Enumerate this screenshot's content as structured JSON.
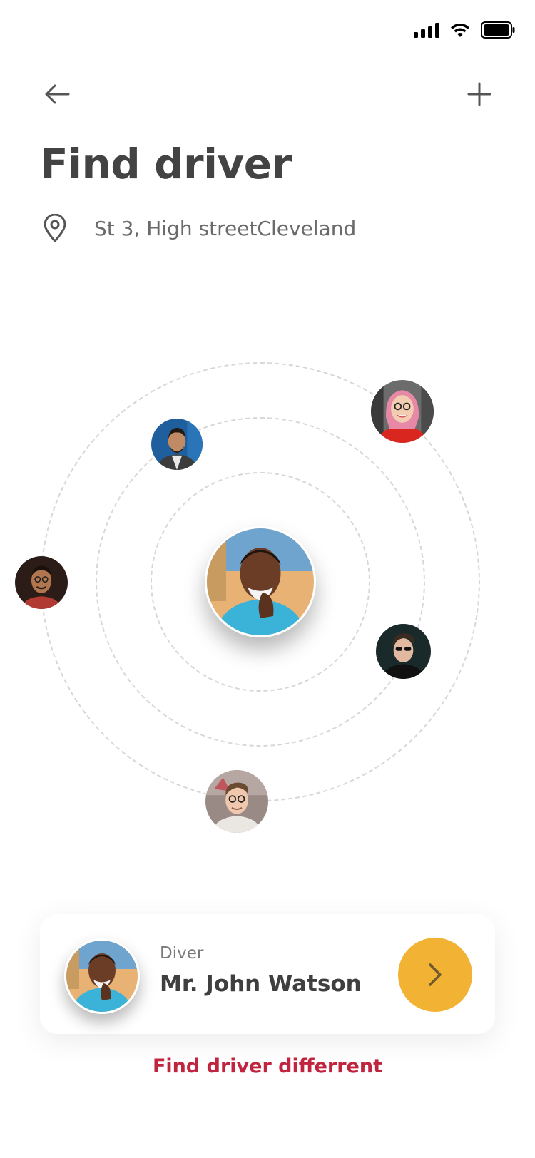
{
  "status_bar": {
    "icons": [
      "signal-icon",
      "wifi-icon",
      "battery-icon"
    ]
  },
  "header": {
    "back_icon": "arrow-left-icon",
    "add_icon": "plus-icon",
    "title": "Find driver"
  },
  "location": {
    "icon": "map-pin-icon",
    "address": "St 3, High streetCleveland"
  },
  "nearby_drivers": {
    "center": {
      "icon": "driver-photo"
    },
    "others": [
      "driver-photo",
      "driver-photo",
      "driver-photo",
      "driver-photo",
      "driver-photo",
      "driver-photo"
    ]
  },
  "driver_card": {
    "label": "Diver",
    "name": "Mr. John Watson",
    "action_icon": "chevron-right-icon"
  },
  "alt_link": "Find driver differrent",
  "colors": {
    "accent": "#f2b233",
    "link": "#c0243f",
    "title": "#434343",
    "muted": "#6a6a6a"
  }
}
